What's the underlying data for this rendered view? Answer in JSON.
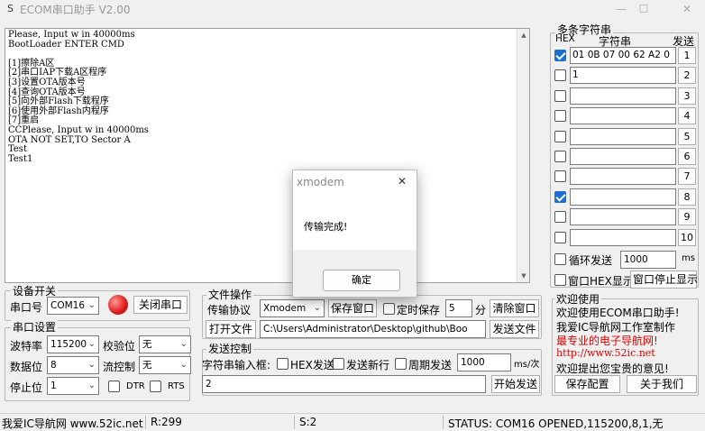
{
  "window": {
    "title": "ECOM串口助手  V2.00",
    "app_icon": "S",
    "controls": [
      "—",
      "☐",
      "✕"
    ]
  },
  "terminal": {
    "lines": [
      "Please, Input w in 40000ms",
      "BootLoader ENTER CMD",
      "",
      "[1]擦除A区",
      "[2]串口IAP下载A区程序",
      "[3]设置OTA版本号",
      "[4]查询OTA版本号",
      "[5]向外部Flash下载程序",
      "[6]使用外部Flash内程序",
      "[7]重启",
      "CCPlease, Input w in 40000ms",
      "OTA NOT SET,TO Sector A",
      "Test",
      "Test1"
    ]
  },
  "device": {
    "group_label": "设备开关",
    "port_label": "串口号",
    "port_value": "COM16",
    "close_button": "关闭串口",
    "indicator_color": "#e02020"
  },
  "serial_settings": {
    "group_label": "串口设置",
    "baud_label": "波特率",
    "baud_value": "115200",
    "parity_label": "校验位",
    "parity_value": "无",
    "databits_label": "数据位",
    "databits_value": "8",
    "flow_label": "流控制",
    "flow_value": "无",
    "stopbits_label": "停止位",
    "stopbits_value": "1",
    "dtr_label": "DTR",
    "rts_label": "RTS"
  },
  "file_ops": {
    "group_label": "文件操作",
    "protocol_label": "传输协议",
    "protocol_value": "Xmodem",
    "save_window": "保存窗口",
    "timed_save": "定时保存",
    "timed_value": "5",
    "minute_unit": "分",
    "clear_window": "清除窗口",
    "open_file": "打开文件",
    "file_path": "C:\\Users\\Administrator\\Desktop\\github\\Boo",
    "send_file": "发送文件"
  },
  "send_control": {
    "group_label": "发送控制",
    "input_label": "字符串输入框:",
    "hex_send": "HEX发送",
    "send_newline": "发送新行",
    "periodic_send": "周期发送",
    "period_value": "1000",
    "period_unit": "ms/次",
    "input_value": "2",
    "start_send": "开始发送"
  },
  "multi_string": {
    "title": "多条字符串",
    "hex_header": "HEX",
    "string_header": "字符串",
    "send_header": "发送",
    "rows": [
      {
        "hex": true,
        "value": "01 0B 07 00 62 A2 0",
        "button": "1"
      },
      {
        "hex": false,
        "value": "1",
        "button": "2"
      },
      {
        "hex": false,
        "value": "",
        "button": "3"
      },
      {
        "hex": false,
        "value": "",
        "button": "4"
      },
      {
        "hex": false,
        "value": "",
        "button": "5"
      },
      {
        "hex": false,
        "value": "",
        "button": "6"
      },
      {
        "hex": false,
        "value": "",
        "button": "7"
      },
      {
        "hex": true,
        "value": "",
        "button": "8"
      },
      {
        "hex": false,
        "value": "",
        "button": "9"
      },
      {
        "hex": false,
        "value": "",
        "button": "10"
      }
    ],
    "loop_send": "循环发送",
    "loop_value": "1000",
    "loop_unit": "ms",
    "window_hex": "窗口HEX显示",
    "window_stop": "窗口停止显示"
  },
  "welcome": {
    "group_label": "欢迎使用",
    "line1": "欢迎使用ECOM串口助手!",
    "line2": "我爱IC导航网工作室制作",
    "line3": "最专业的电子导航网!",
    "line4": "http://www.52ic.net",
    "line5": "欢迎提出您宝贵的意见!",
    "save_config": "保存配置",
    "about": "关于我们",
    "accent_red": "#e00000",
    "accent_blue": "#1e3cff"
  },
  "status": {
    "site": "我爱IC导航网 www.52ic.net",
    "received": "R:299",
    "sent": "S:2",
    "status_text": "STATUS:  COM16 OPENED,115200,8,1,无"
  },
  "dialog": {
    "title": "xmodem",
    "message": "传输完成!",
    "ok": "确定",
    "close": "✕"
  }
}
